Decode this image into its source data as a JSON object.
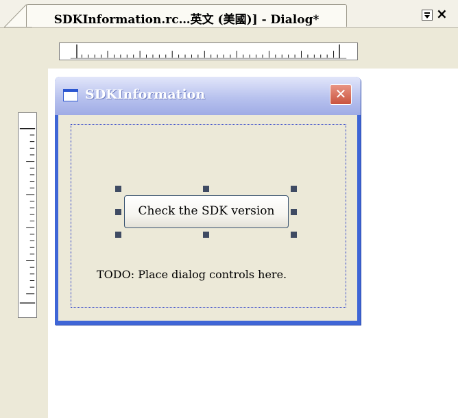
{
  "tab": {
    "title": "SDKInformation.rc…英文 (美國)] - Dialog*"
  },
  "tab_controls": {
    "dropdown_icon": "dropdown-icon",
    "close_label": "×"
  },
  "dialog": {
    "title": "SDKInformation",
    "close_label": "✕",
    "button_label": "Check the SDK version",
    "static_text": "TODO: Place dialog controls here."
  },
  "colors": {
    "dialog_frame": "#3f66d6",
    "close_button": "#c9533e",
    "selection_handle": "#3f4b63",
    "guide_line": "#2237c8"
  }
}
